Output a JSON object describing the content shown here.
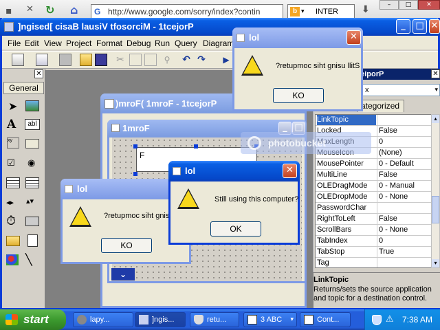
{
  "browser": {
    "address": "http://www.google.com/sorry/index?contin",
    "search_engine": "INTER"
  },
  "ide": {
    "title": "]ngised[ cisaB lausiV tfosorciM - 1tcejorP",
    "menus": [
      "File",
      "Edit",
      "View",
      "Project",
      "Format",
      "Debug",
      "Run",
      "Query",
      "Diagram"
    ],
    "toolbox_tab": "General",
    "toolbox_label_tool": "A",
    "toolbox_textbox_tool": "abl",
    "toolbox_frame_tool": "xy"
  },
  "form_designer": {
    "title": ")mroF( 1mroF - 1tcejorP",
    "form_title": "1mroF",
    "textbox_text": "F"
  },
  "properties": {
    "title": "seiporP",
    "object_short": "x",
    "tab_categorized": "ategorized",
    "rows": [
      {
        "key": "LinkTopic",
        "value": ""
      },
      {
        "key": "Locked",
        "value": "False"
      },
      {
        "key": "MaxLength",
        "value": "0"
      },
      {
        "key": "MouseIcon",
        "value": "(None)"
      },
      {
        "key": "MousePointer",
        "value": "0 - Default"
      },
      {
        "key": "MultiLine",
        "value": "False"
      },
      {
        "key": "OLEDragMode",
        "value": "0 - Manual"
      },
      {
        "key": "OLEDropMode",
        "value": "0 - None"
      },
      {
        "key": "PasswordChar",
        "value": ""
      },
      {
        "key": "RightToLeft",
        "value": "False"
      },
      {
        "key": "ScrollBars",
        "value": "0 - None"
      },
      {
        "key": "TabIndex",
        "value": "0"
      },
      {
        "key": "TabStop",
        "value": "True"
      },
      {
        "key": "Tag",
        "value": ""
      }
    ],
    "desc_title": "LinkTopic",
    "desc_text": "Returns/sets the source application and topic for a destination control."
  },
  "watermark": "photobucket",
  "dialogs": [
    {
      "title": "lol",
      "message": "?retupmoc siht gnisu llitS",
      "button": "KO"
    },
    {
      "title": "lol",
      "message": "?retupmoc siht gnisu llitS",
      "button": "KO"
    },
    {
      "title": "lol",
      "message": "Still using this computer?",
      "button": "OK"
    }
  ],
  "taskbar": {
    "start": "start",
    "tasks": [
      "lapy...",
      "]ngis...",
      "retu...",
      "3 ABC",
      "Cont..."
    ],
    "clock": "7:38 AM"
  },
  "colors": {
    "xp_title_active": "#0548c9",
    "taskbar": "#245edb",
    "start_button": "#3c9a2f",
    "selected_row": "#316ac5"
  }
}
